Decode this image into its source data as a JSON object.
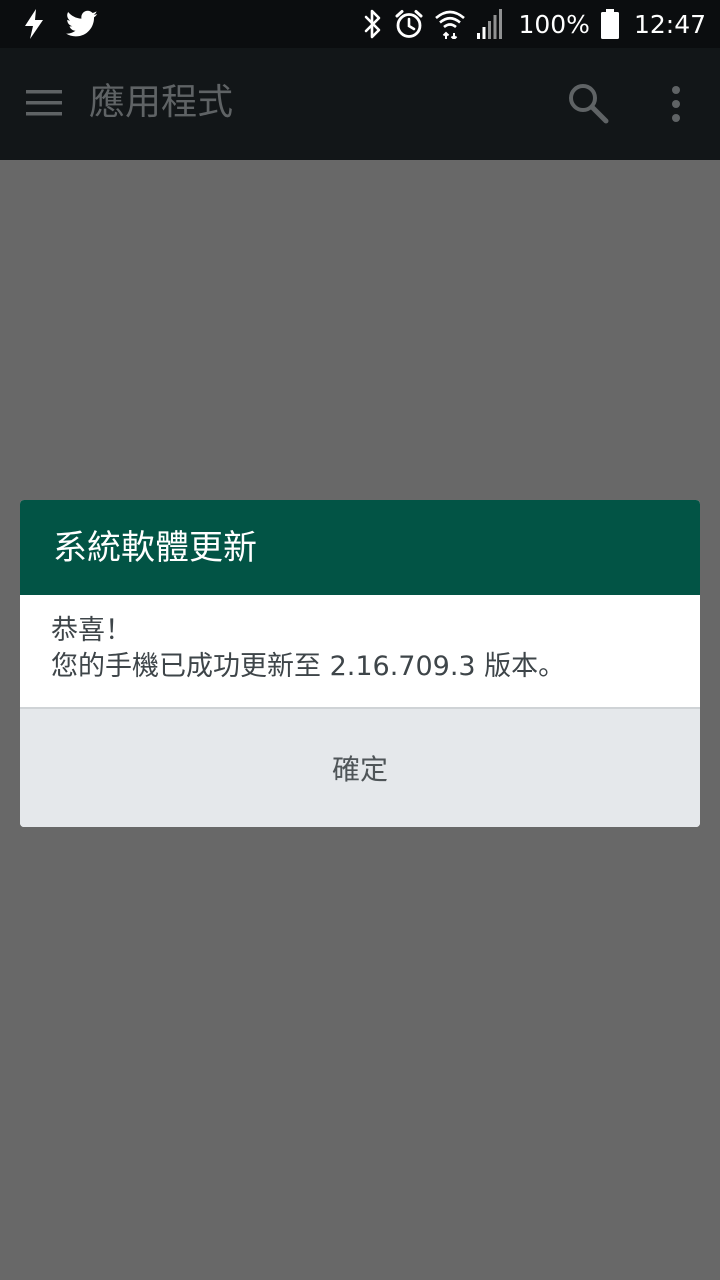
{
  "status_bar": {
    "left_icons": [
      "flash-icon",
      "twitter-icon"
    ],
    "right_icons": [
      "bluetooth-icon",
      "alarm-icon",
      "wifi-icon",
      "signal-icon",
      "battery-icon"
    ],
    "battery_percent": "100%",
    "time": "12:47"
  },
  "app_bar": {
    "title": "應用程式",
    "icons": [
      "menu-icon",
      "search-icon",
      "more-vert-icon"
    ]
  },
  "dialog": {
    "title": "系統軟體更新",
    "message_line1": "恭喜！",
    "message_line2": "您的手機已成功更新至 2.16.709.3 版本。",
    "ok_button": "確定"
  },
  "colors": {
    "status_bar_bg": "#0b0d0f",
    "app_bar_bg": "#121618",
    "scrim": "#686868",
    "dialog_header": "#025445",
    "dialog_footer": "#e5e8eb"
  }
}
